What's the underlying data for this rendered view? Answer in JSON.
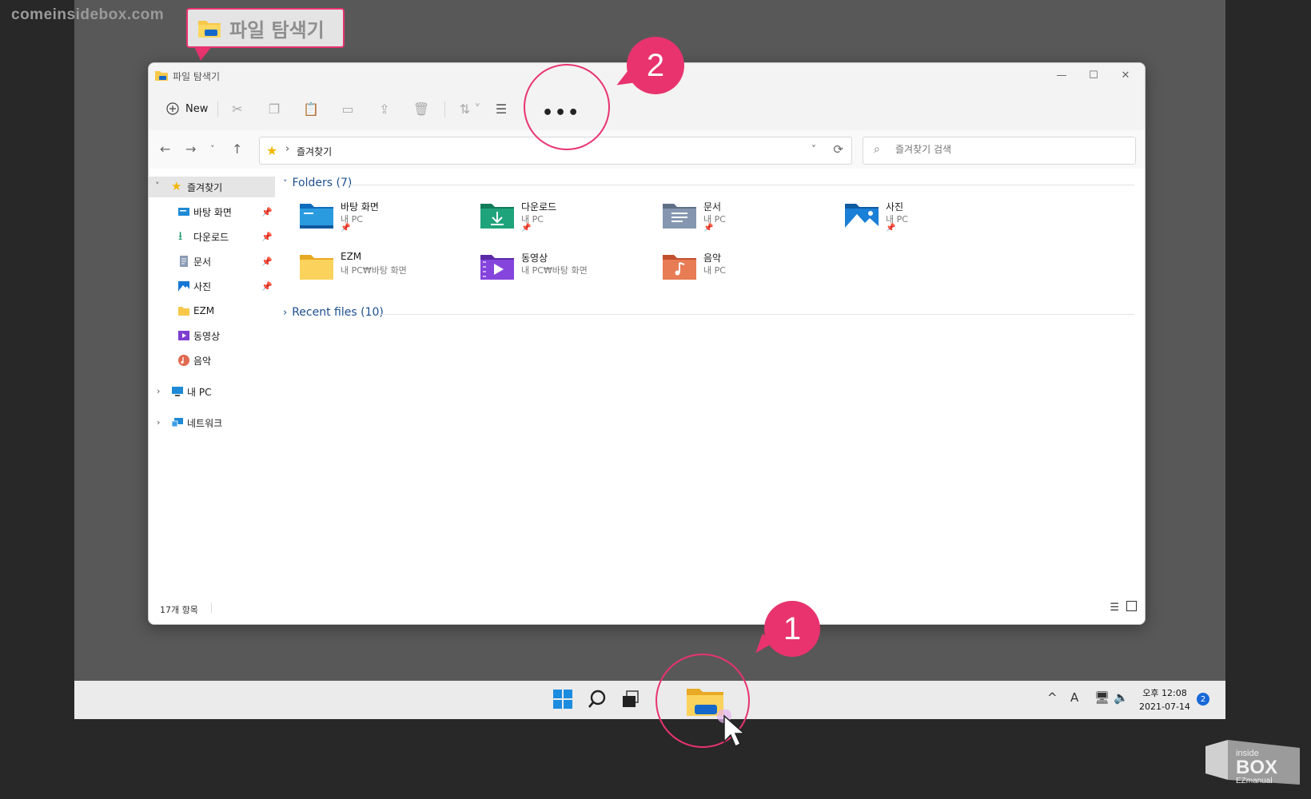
{
  "watermark": "comeinsidebox.com",
  "callout": {
    "title": "파일 탐색기"
  },
  "window": {
    "title": "파일 탐색기",
    "controls": {
      "minimize": "—",
      "maximize": "☐",
      "close": "✕"
    }
  },
  "toolbar": {
    "new_label": "New",
    "more_label": "•••"
  },
  "address": {
    "path": "즐겨찾기",
    "search_placeholder": "즐겨찾기 검색"
  },
  "sidebar": {
    "favorites": "즐겨찾기",
    "items": [
      {
        "label": "바탕 화면",
        "pinned": true,
        "icon": "desktop-folder-icon"
      },
      {
        "label": "다운로드",
        "pinned": true,
        "icon": "download-folder-icon"
      },
      {
        "label": "문서",
        "pinned": true,
        "icon": "documents-folder-icon"
      },
      {
        "label": "사진",
        "pinned": true,
        "icon": "pictures-folder-icon"
      },
      {
        "label": "EZM",
        "pinned": false,
        "icon": "folder-icon"
      },
      {
        "label": "동영상",
        "pinned": false,
        "icon": "videos-folder-icon"
      },
      {
        "label": "음악",
        "pinned": false,
        "icon": "music-folder-icon"
      }
    ],
    "this_pc": "내 PC",
    "network": "네트워크"
  },
  "content": {
    "folders_header": "Folders (7)",
    "recent_header": "Recent files (10)",
    "folders": [
      {
        "name": "바탕 화면",
        "location": "내 PC",
        "pinned": true
      },
      {
        "name": "다운로드",
        "location": "내 PC",
        "pinned": true
      },
      {
        "name": "문서",
        "location": "내 PC",
        "pinned": true
      },
      {
        "name": "사진",
        "location": "내 PC",
        "pinned": true
      },
      {
        "name": "EZM",
        "location": "내 PC₩바탕 화면",
        "pinned": false
      },
      {
        "name": "동영상",
        "location": "내 PC₩바탕 화면",
        "pinned": false
      },
      {
        "name": "음악",
        "location": "내 PC",
        "pinned": false
      }
    ]
  },
  "status": {
    "item_count": "17개 항목"
  },
  "taskbar": {
    "time": "오후 12:08",
    "date": "2021-07-14",
    "notifications": "2",
    "ime": "A"
  },
  "annotations": {
    "step1": "1",
    "step2": "2"
  },
  "logo": {
    "text": "inside BOX EZmanual"
  },
  "colors": {
    "accent": "#e8336f",
    "folder_yellow": "#f8c84a",
    "link_blue": "#1e4f8f"
  }
}
